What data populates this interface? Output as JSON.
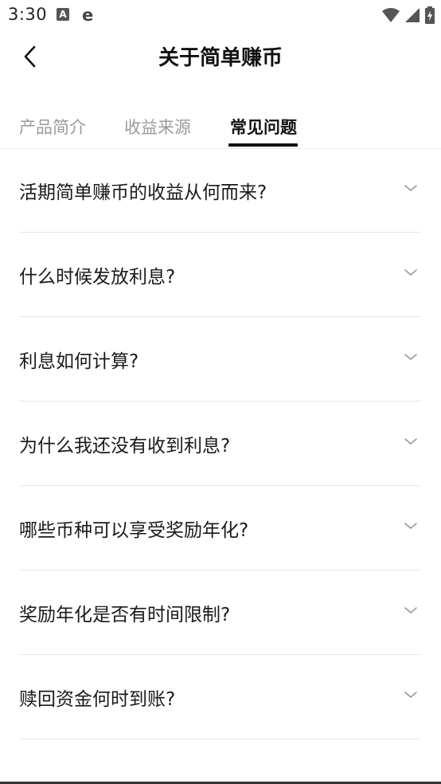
{
  "status_bar": {
    "time": "3:30",
    "a_icon_label": "A",
    "e_icon_label": "e"
  },
  "header": {
    "title": "关于简单赚币"
  },
  "tabs": [
    {
      "label": "产品简介",
      "active": false
    },
    {
      "label": "收益来源",
      "active": false
    },
    {
      "label": "常见问题",
      "active": true
    }
  ],
  "faq": [
    {
      "question": "活期简单赚币的收益从何而来?"
    },
    {
      "question": "什么时候发放利息?"
    },
    {
      "question": "利息如何计算?"
    },
    {
      "question": "为什么我还没有收到利息?"
    },
    {
      "question": "哪些币种可以享受奖励年化?"
    },
    {
      "question": "奖励年化是否有时间限制?"
    },
    {
      "question": "赎回资金何时到账?"
    }
  ],
  "colors": {
    "text_primary": "#111111",
    "text_inactive": "#9a9a9a",
    "divider": "#e6e6e6"
  }
}
